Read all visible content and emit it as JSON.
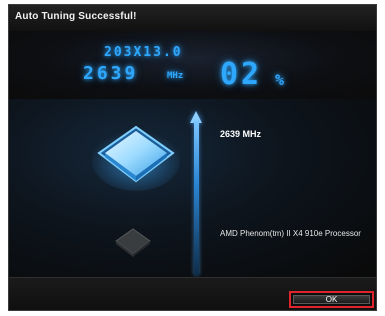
{
  "dialog": {
    "title": "Auto Tuning Successful!"
  },
  "header": {
    "formula": "203X13.0",
    "frequency_value": "2639",
    "frequency_unit": "MHz",
    "percent_value": "02",
    "percent_sign": "%",
    "accent_color": "#2ea8ff"
  },
  "main": {
    "frequency_label": "2639 MHz",
    "cpu_name": "AMD Phenom(tm) II X4 910e Processor",
    "icons": [
      "cpu-chip-icon",
      "up-arrow-icon",
      "cpu-chip-dim-icon"
    ]
  },
  "footer": {
    "ok_label": "OK",
    "ok_border_color": "#e0242b"
  }
}
